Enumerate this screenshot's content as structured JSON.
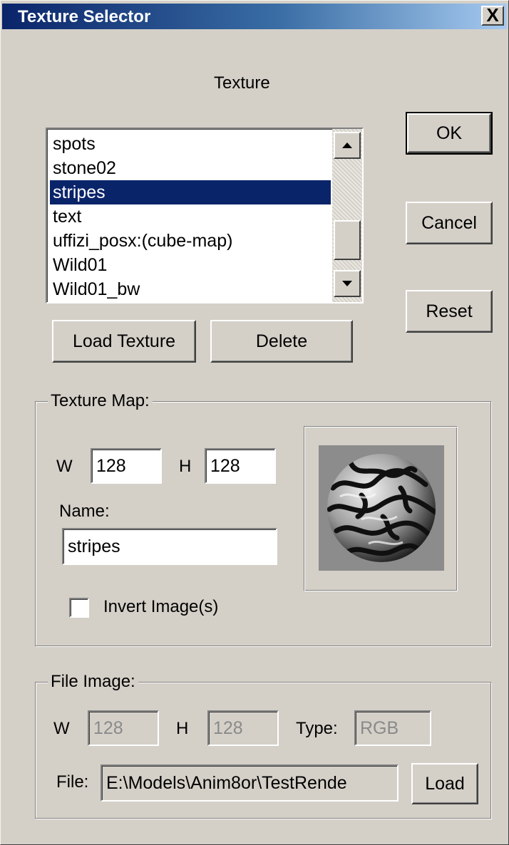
{
  "window": {
    "title": "Texture Selector",
    "close_glyph": "X"
  },
  "texture_heading": "Texture",
  "texture_list": {
    "items": [
      {
        "label": "spots",
        "selected": false
      },
      {
        "label": "stone02",
        "selected": false
      },
      {
        "label": "stripes",
        "selected": true
      },
      {
        "label": "text",
        "selected": false
      },
      {
        "label": "uffizi_posx:(cube-map)",
        "selected": false
      },
      {
        "label": "Wild01",
        "selected": false
      },
      {
        "label": "Wild01_bw",
        "selected": false
      }
    ]
  },
  "buttons": {
    "ok": "OK",
    "cancel": "Cancel",
    "reset": "Reset",
    "load_texture": "Load Texture",
    "delete": "Delete",
    "load": "Load"
  },
  "texture_map": {
    "legend": "Texture Map:",
    "w_label": "W",
    "w_value": "128",
    "h_label": "H",
    "h_value": "128",
    "name_label": "Name:",
    "name_value": "stripes",
    "invert_label": "Invert Image(s)",
    "invert_checked": false,
    "preview_icon": "textured-sphere-preview"
  },
  "file_image": {
    "legend": "File Image:",
    "w_label": "W",
    "w_value": "128",
    "h_label": "H",
    "h_value": "128",
    "type_label": "Type:",
    "type_value": "RGB",
    "file_label": "File:",
    "file_value": "E:\\Models\\Anim8or\\TestRende"
  },
  "colors": {
    "dialog_bg": "#d4d0c8",
    "title_start": "#0a246a",
    "title_end": "#a6caf0",
    "selection": "#0a246a"
  }
}
